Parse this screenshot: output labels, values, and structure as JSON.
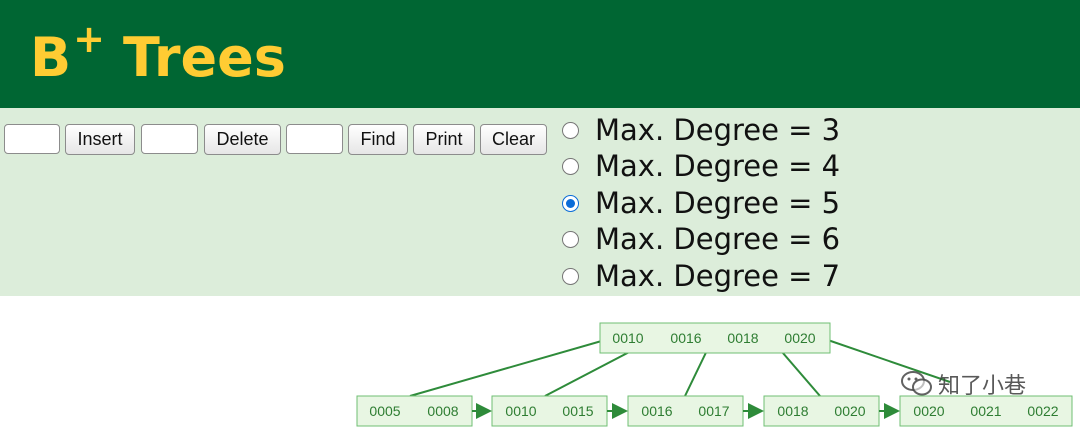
{
  "header": {
    "title_main": "B",
    "title_sup": "+",
    "title_rest": "Trees",
    "bg_color": "#006633",
    "title_color": "#ffcc33"
  },
  "toolbar": {
    "insert_value": "",
    "insert_label": "Insert",
    "delete_value": "",
    "delete_label": "Delete",
    "find_value": "",
    "find_label": "Find",
    "print_label": "Print",
    "clear_label": "Clear"
  },
  "degree_options": [
    {
      "label": "Max. Degree = 3",
      "checked": false
    },
    {
      "label": "Max. Degree = 4",
      "checked": false
    },
    {
      "label": "Max. Degree = 5",
      "checked": true
    },
    {
      "label": "Max. Degree = 6",
      "checked": false
    },
    {
      "label": "Max. Degree = 7",
      "checked": false
    }
  ],
  "tree": {
    "root": [
      "0010",
      "0016",
      "0018",
      "0020"
    ],
    "leaves": [
      [
        "0005",
        "0008"
      ],
      [
        "0010",
        "0015"
      ],
      [
        "0016",
        "0017"
      ],
      [
        "0018",
        "0020"
      ],
      [
        "0020",
        "0021",
        "0022"
      ]
    ],
    "node_color": "#e8f6e3",
    "edge_color": "#2e8b3a"
  },
  "watermark": {
    "icon": "wechat-icon",
    "text": "知了小巷"
  }
}
